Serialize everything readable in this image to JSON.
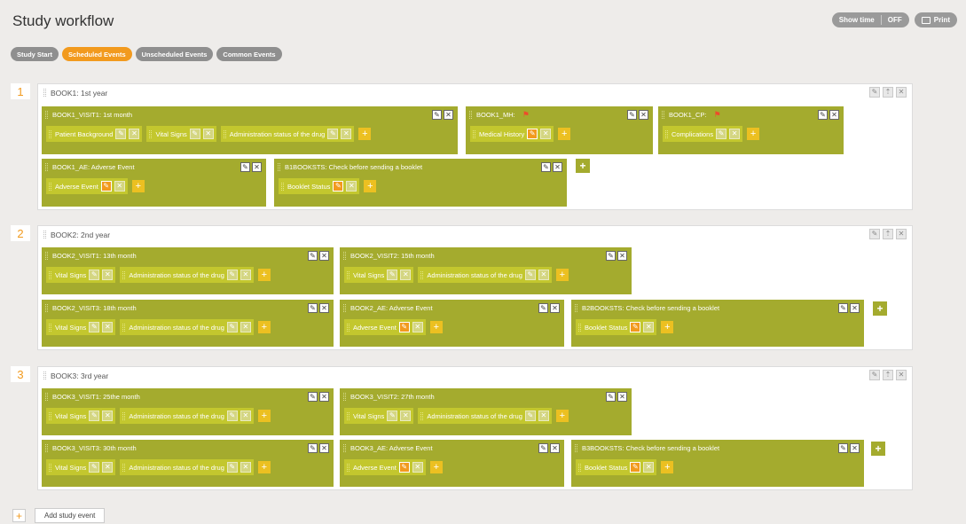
{
  "title": "Study workflow",
  "header_buttons": {
    "show_time": "Show time",
    "off": "OFF",
    "print": "Print"
  },
  "tabs": [
    "Study Start",
    "Scheduled Events",
    "Unscheduled Events",
    "Common Events"
  ],
  "active_tab": "Scheduled Events",
  "colors": {
    "accent": "#f29a1e",
    "event": "#a4ab2e",
    "form": "#c3c72e",
    "flag": "#ee4b2b"
  },
  "books": [
    {
      "number": "1",
      "title": "BOOK1: 1st year",
      "events": [
        {
          "name": "BOOK1_VISIT1: 1st month",
          "forms": [
            "Patient Background",
            "Vital Signs",
            "Administration status of the drug"
          ]
        },
        {
          "name": "BOOK1_MH:",
          "flag": true,
          "forms": [
            "Medical History"
          ]
        },
        {
          "name": "BOOK1_CP:",
          "flag": true,
          "forms": [
            "Complications"
          ]
        },
        {
          "name": "BOOK1_AE: Adverse Event",
          "forms": [
            "Adverse Event"
          ]
        },
        {
          "name": "B1BOOKSTS: Check before sending a booklet",
          "forms": [
            "Booklet Status"
          ]
        }
      ]
    },
    {
      "number": "2",
      "title": "BOOK2: 2nd year",
      "events": [
        {
          "name": "BOOK2_VISIT1: 13th month",
          "forms": [
            "Vital Signs",
            "Administration status of the drug"
          ]
        },
        {
          "name": "BOOK2_VISIT2: 15th month",
          "forms": [
            "Vital Signs",
            "Administration status of the drug"
          ]
        },
        {
          "name": "BOOK2_VISIT3: 18th month",
          "forms": [
            "Vital Signs",
            "Administration status of the drug"
          ]
        },
        {
          "name": "BOOK2_AE: Adverse Event",
          "forms": [
            "Adverse Event"
          ]
        },
        {
          "name": "B2BOOKSTS: Check before sending a booklet",
          "forms": [
            "Booklet Status"
          ]
        }
      ]
    },
    {
      "number": "3",
      "title": "BOOK3: 3rd year",
      "events": [
        {
          "name": "BOOK3_VISIT1: 25the month",
          "forms": [
            "Vital Signs",
            "Administration status of the drug"
          ]
        },
        {
          "name": "BOOK3_VISIT2: 27th month",
          "forms": [
            "Vital Signs",
            "Administration status of the drug"
          ]
        },
        {
          "name": "BOOK3_VISIT3: 30th month",
          "forms": [
            "Vital Signs",
            "Administration status of the drug"
          ]
        },
        {
          "name": "BOOK3_AE: Adverse Event",
          "forms": [
            "Adverse Event"
          ]
        },
        {
          "name": "B3BOOKSTS: Check before sending a booklet",
          "forms": [
            "Booklet Status"
          ]
        }
      ]
    }
  ],
  "add_study_event": "Add study event"
}
